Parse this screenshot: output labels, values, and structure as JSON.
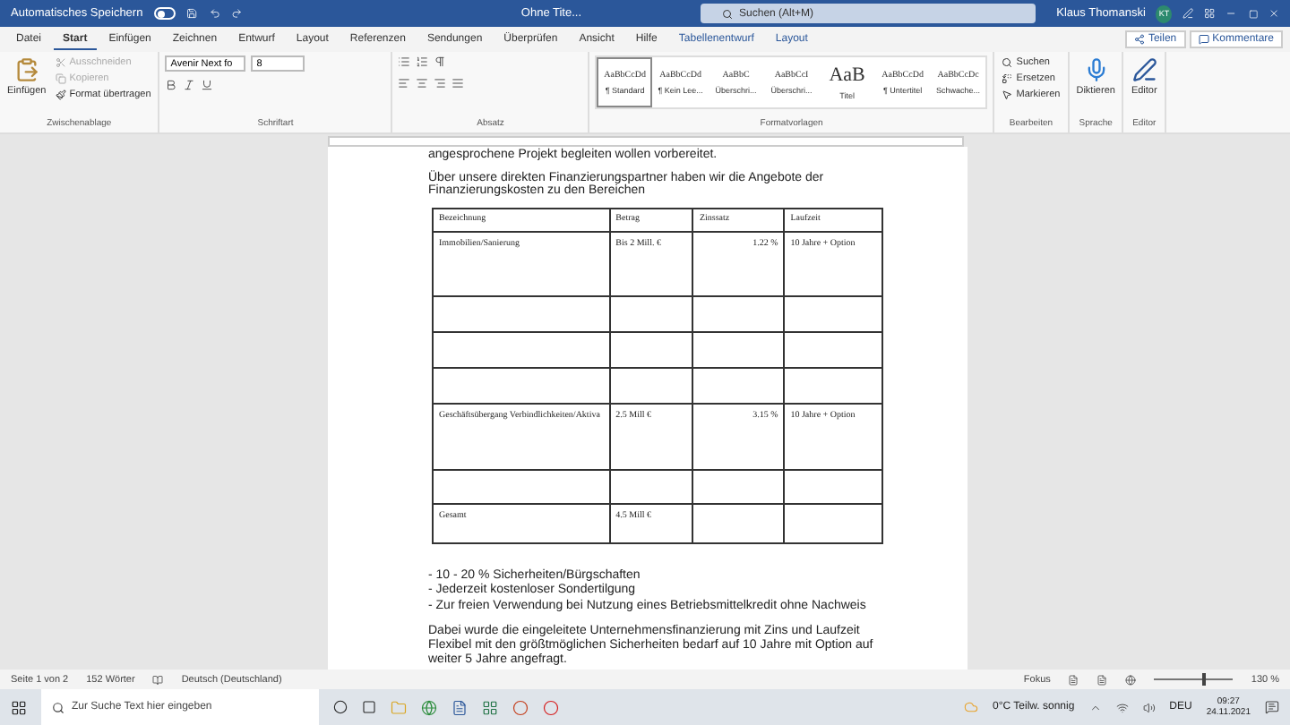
{
  "title_bar": {
    "autosave_label": "Automatisches Speichern",
    "autosave_on": false,
    "doc_title": "Ohne Tite...",
    "search_placeholder": "Suchen (Alt+M)",
    "user_name": "Klaus Thomanski",
    "user_initials": "KT"
  },
  "tabs": [
    {
      "label": "Datei",
      "selected": false,
      "kind": "normal"
    },
    {
      "label": "Start",
      "selected": true,
      "kind": "normal"
    },
    {
      "label": "Einfügen",
      "selected": false,
      "kind": "normal"
    },
    {
      "label": "Zeichnen",
      "selected": false,
      "kind": "normal"
    },
    {
      "label": "Entwurf",
      "selected": false,
      "kind": "normal"
    },
    {
      "label": "Layout",
      "selected": false,
      "kind": "normal"
    },
    {
      "label": "Referenzen",
      "selected": false,
      "kind": "normal"
    },
    {
      "label": "Sendungen",
      "selected": false,
      "kind": "normal"
    },
    {
      "label": "Überprüfen",
      "selected": false,
      "kind": "normal"
    },
    {
      "label": "Ansicht",
      "selected": false,
      "kind": "normal"
    },
    {
      "label": "Hilfe",
      "selected": false,
      "kind": "normal"
    },
    {
      "label": "Tabellenentwurf",
      "selected": false,
      "kind": "context"
    },
    {
      "label": "Layout",
      "selected": false,
      "kind": "context"
    }
  ],
  "share_button": "Teilen",
  "comments_button": "Kommentare",
  "ribbon": {
    "clipboard": {
      "paste": "Einfügen",
      "items": [
        {
          "label": "Ausschneiden",
          "disabled": true
        },
        {
          "label": "Kopieren",
          "disabled": true
        },
        {
          "label": "Format übertragen",
          "disabled": false
        }
      ],
      "group_label": "Zwischenablage"
    },
    "font": {
      "font_name": "Avenir Next fo",
      "font_size": "8",
      "group_label": "Schriftart"
    },
    "paragraph": {
      "group_label": "Absatz"
    },
    "styles": {
      "items": [
        {
          "sample": "AaBbCcDd",
          "name": "¶ Standard",
          "selected": true
        },
        {
          "sample": "AaBbCcDd",
          "name": "¶ Kein Lee...",
          "selected": false
        },
        {
          "sample": "AaBbC",
          "name": "Überschri...",
          "selected": false
        },
        {
          "sample": "AaBbCcI",
          "name": "Überschri...",
          "selected": false
        },
        {
          "sample": "AaB",
          "name": "Titel",
          "selected": false
        },
        {
          "sample": "AaBbCcDd",
          "name": "¶ Untertitel",
          "selected": false
        },
        {
          "sample": "AaBbCcDc",
          "name": "Schwache...",
          "selected": false
        }
      ],
      "group_label": "Formatvorlagen"
    },
    "editing": {
      "items": [
        "Suchen",
        "Ersetzen",
        "Markieren"
      ],
      "group_label": "Bearbeiten"
    },
    "voice": {
      "button": "Diktieren",
      "group_label": "Sprache"
    },
    "editor": {
      "button": "Editor",
      "group_label": "Editor"
    }
  },
  "document": {
    "paragraphs_before": [
      "angesprochene Projekt begleiten wollen vorbereitet.",
      "Über unsere direkten Finanzierungspartner haben wir die Angebote der Finanzierungskosten zu den Bereichen"
    ],
    "table": {
      "columns": [
        "Bezeichnung",
        "Betrag",
        "Zinssatz",
        "Laufzeit"
      ],
      "rows": [
        {
          "cells": [
            "Immobilien/Sanierung",
            "Bis 2 Mill. €",
            "1.22 %",
            "10 Jahre + Option"
          ]
        },
        {
          "cells": [
            "",
            "",
            "",
            ""
          ]
        },
        {
          "cells": [
            "",
            "",
            "",
            ""
          ]
        },
        {
          "cells": [
            "",
            "",
            "",
            ""
          ]
        },
        {
          "cells": [
            "Geschäftsübergang Verbindlichkeiten/Aktiva",
            "2.5 Mill €",
            "3.15 %",
            "10 Jahre + Option"
          ]
        },
        {
          "cells": [
            "",
            "",
            "",
            ""
          ]
        },
        {
          "cells": [
            "Gesamt",
            "4.5 Mill €",
            "",
            ""
          ]
        }
      ]
    },
    "bullets": [
      "- 10 - 20 % Sicherheiten/Bürgschaften",
      "- Jederzeit kostenloser Sondertilgung",
      "- Zur freien Verwendung bei Nutzung eines Betriebsmittelkredit ohne Nachweis"
    ],
    "paragraph_after": "Dabei wurde die eingeleitete Unternehmensfinanzierung mit Zins und Laufzeit Flexibel mit den größtmöglichen Sicherheiten bedarf auf 10 Jahre mit Option auf weiter 5 Jahre angefragt."
  },
  "status_bar": {
    "page": "Seite 1 von 2",
    "words": "152 Wörter",
    "language": "Deutsch (Deutschland)",
    "focus": "Fokus",
    "zoom": {
      "level": 0.6
    },
    "zoom_label": "130 %"
  },
  "taskbar": {
    "search_placeholder": "Zur Suche Text hier eingeben",
    "weather": "0°C  Teilw. sonnig",
    "language": "DEU",
    "time": "09:27",
    "date": "24.11.2021"
  }
}
